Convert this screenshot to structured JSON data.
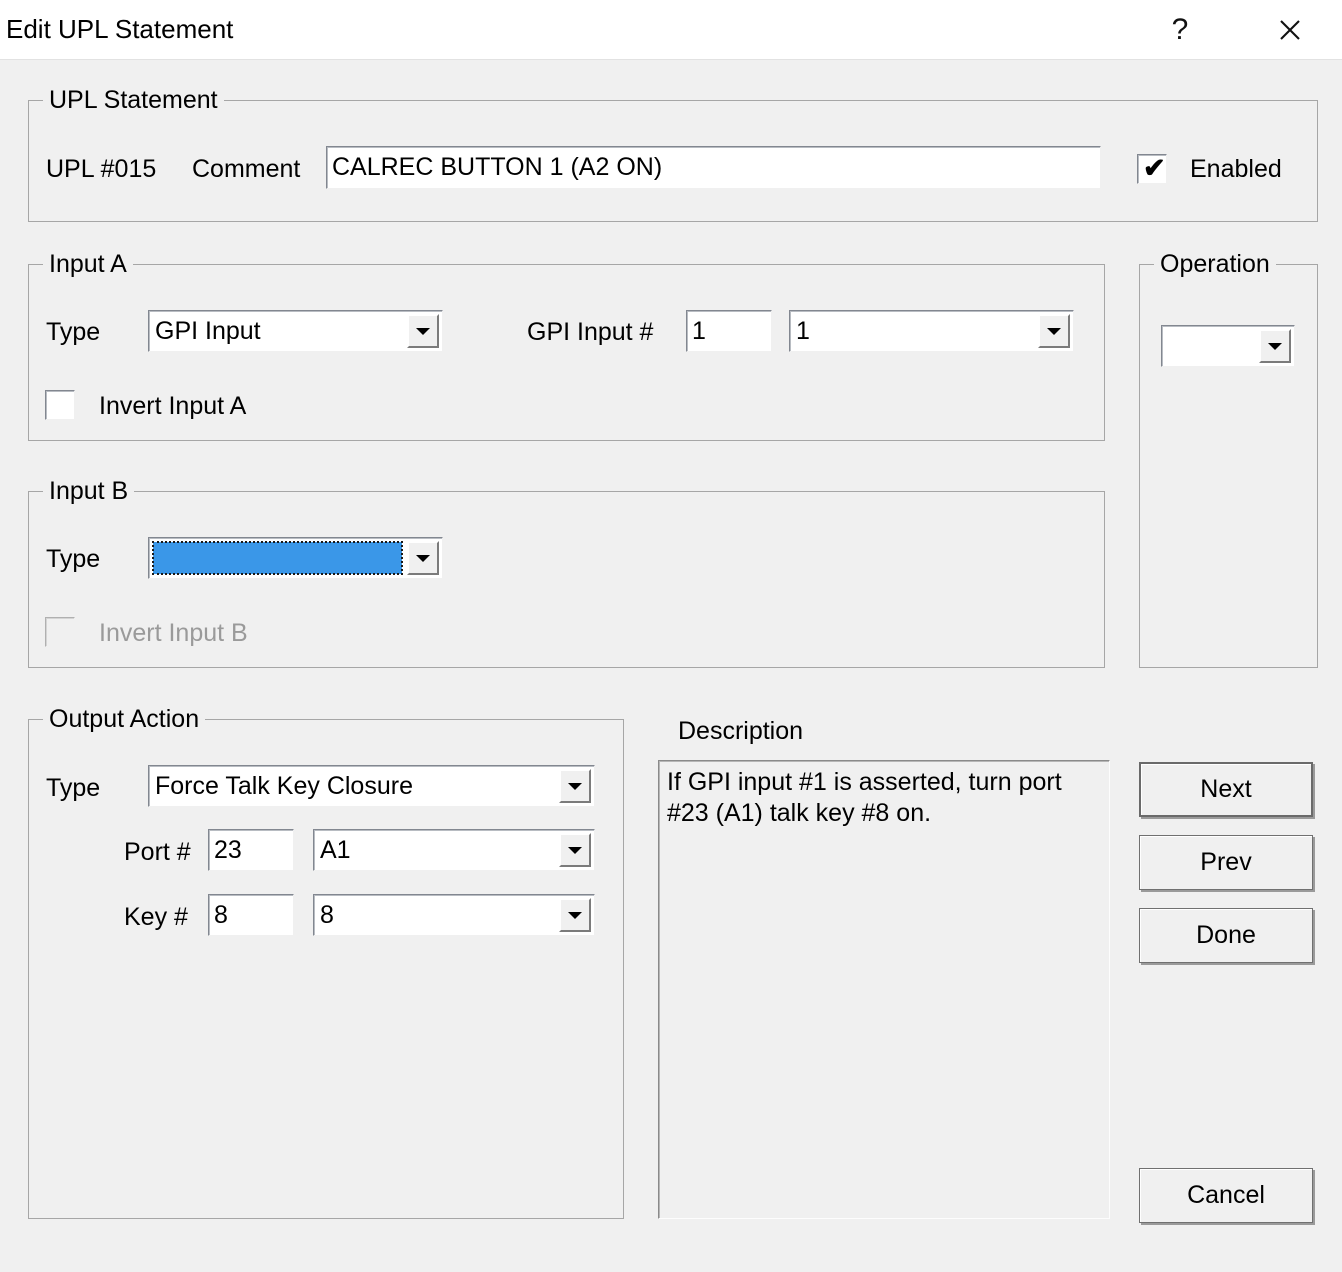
{
  "window": {
    "title": "Edit UPL Statement",
    "help_icon": "?",
    "close_icon": "close-icon"
  },
  "upl_statement": {
    "legend": "UPL Statement",
    "number_label": "UPL #015",
    "comment_label": "Comment",
    "comment_value": "CALREC BUTTON 1 (A2 ON)",
    "enabled_label": "Enabled",
    "enabled_checked": true,
    "enabled_tick": "✔"
  },
  "input_a": {
    "legend": "Input A",
    "type_label": "Type",
    "type_value": "GPI Input",
    "gpi_label": "GPI Input #",
    "gpi_number": "1",
    "gpi_select_value": "1",
    "invert_label": "Invert Input A",
    "invert_checked": false
  },
  "input_b": {
    "legend": "Input B",
    "type_label": "Type",
    "type_value": "",
    "type_focused": true,
    "invert_label": "Invert Input B",
    "invert_checked": false,
    "invert_disabled": true
  },
  "operation": {
    "legend": "Operation",
    "value": ""
  },
  "output_action": {
    "legend": "Output Action",
    "type_label": "Type",
    "type_value": "Force Talk Key Closure",
    "port_label": "Port #",
    "port_number": "23",
    "port_select_value": "A1",
    "key_label": "Key #",
    "key_number": "8",
    "key_select_value": "8"
  },
  "description": {
    "legend": "Description",
    "text": "If GPI input #1 is asserted, turn port #23 (A1) talk key #8 on."
  },
  "buttons": {
    "next": "Next",
    "prev": "Prev",
    "done": "Done",
    "cancel": "Cancel"
  },
  "colors": {
    "dialog_bg": "#f0f0f0",
    "titlebar_bg": "#ffffff",
    "selection_blue": "#3a97e8",
    "group_border": "#a6a6a6"
  }
}
